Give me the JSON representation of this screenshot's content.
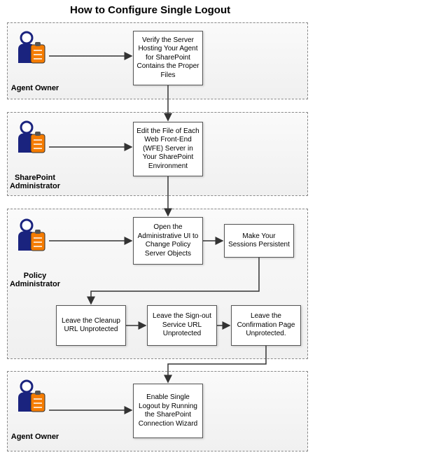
{
  "title": "How to Configure Single Logout",
  "lanes": [
    {
      "id": "lane1",
      "role": "Agent Owner"
    },
    {
      "id": "lane2",
      "role": "SharePoint Administrator"
    },
    {
      "id": "lane3",
      "role": "Policy Administrator"
    },
    {
      "id": "lane4",
      "role": "Agent Owner"
    }
  ],
  "nodes": {
    "n1": "Verify the Server Hosting Your Agent for SharePoint Contains the Proper Files",
    "n2": "Edit the File of Each Web Front-End (WFE) Server in Your SharePoint Environment",
    "n3": "Open the Administrative UI to Change Policy Server Objects",
    "n4": "Make Your Sessions Persistent",
    "n5": "Leave the Cleanup URL Unprotected",
    "n6": "Leave the Sign-out Service URL Unprotected",
    "n7": "Leave the Confirmation Page Unprotected.",
    "n8": "Enable Single Logout by Running the SharePoint Connection Wizard"
  }
}
